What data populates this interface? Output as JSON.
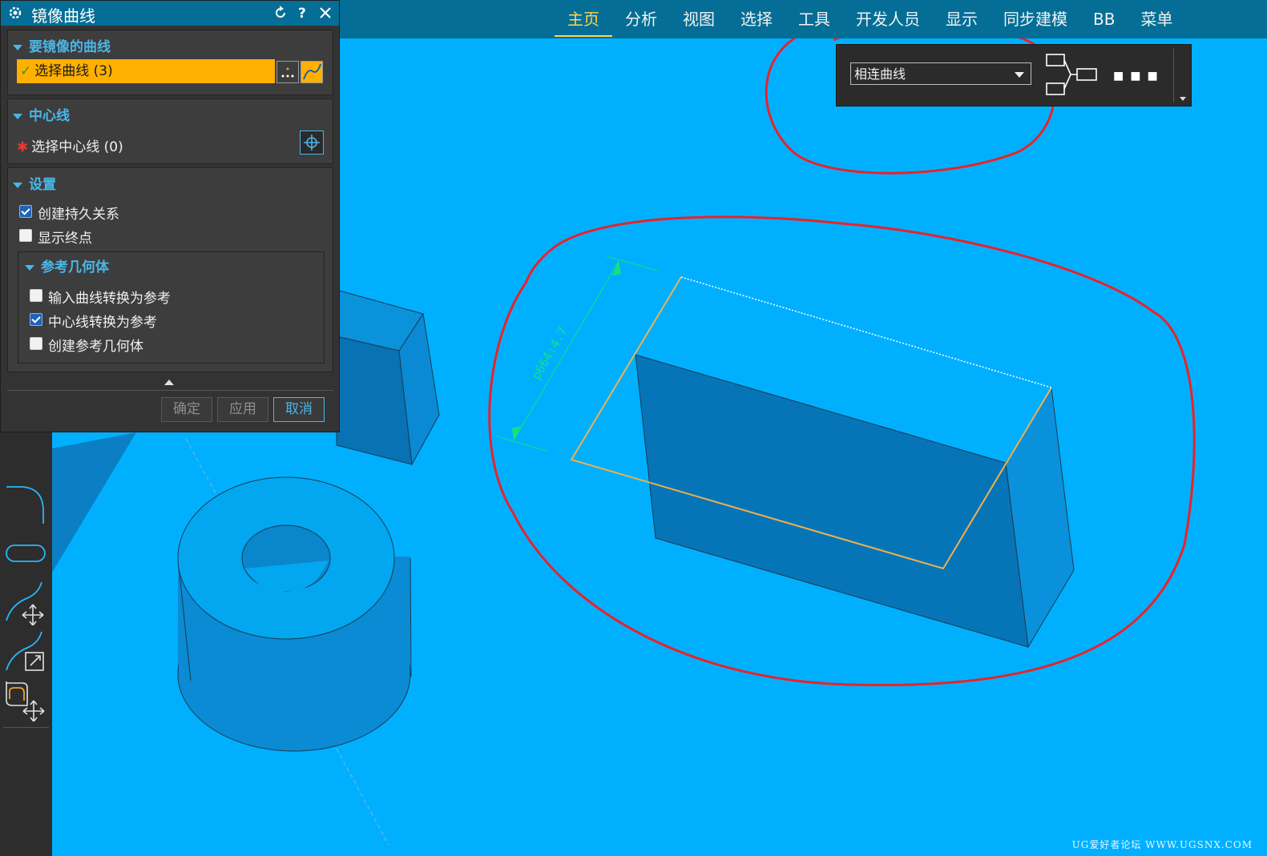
{
  "dialog": {
    "title": "镜像曲线",
    "groups": {
      "curves": {
        "header": "要镜像的曲线",
        "selection_label": "选择曲线 (3)"
      },
      "centerline": {
        "header": "中心线",
        "selection_label": "选择中心线 (0)"
      },
      "settings": {
        "header": "设置",
        "options": [
          {
            "label": "创建持久关系",
            "checked": true
          },
          {
            "label": "显示终点",
            "checked": false
          }
        ],
        "reference": {
          "header": "参考几何体",
          "options": [
            {
              "label": "输入曲线转换为参考",
              "checked": false
            },
            {
              "label": "中心线转换为参考",
              "checked": true
            },
            {
              "label": "创建参考几何体",
              "checked": false
            }
          ]
        }
      }
    },
    "buttons": {
      "ok": "确定",
      "apply": "应用",
      "cancel": "取消"
    }
  },
  "menu": {
    "items": [
      "主页",
      "分析",
      "视图",
      "选择",
      "工具",
      "开发人员",
      "显示",
      "同步建模",
      "BB",
      "菜单"
    ],
    "active_index": 0
  },
  "selection_toolbar": {
    "filter_value": "相连曲线"
  },
  "viewport": {
    "dimension_label": "p664:4.7"
  },
  "watermark": "UG爱好者论坛 WWW.UGSNX.COM",
  "colors": {
    "viewport_background": "#00b0ff",
    "title_bar": "#046e96",
    "panel": "#333333",
    "selection_highlight": "#ffb000",
    "accent_text": "#4ab6e8",
    "annotation_red": "#e8232a"
  }
}
